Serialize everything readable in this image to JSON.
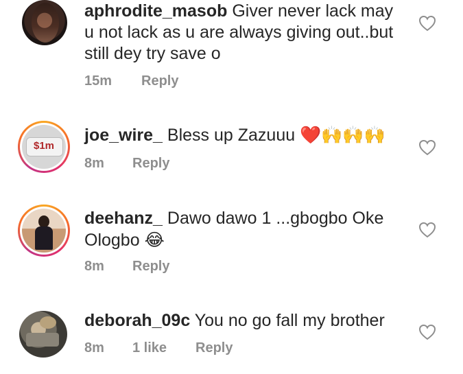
{
  "comments": [
    {
      "username": "aphrodite_masob",
      "text": "Giver never lack may u not lack as u are always giving out..but still dey try save o",
      "time": "15m",
      "likes": "",
      "reply": "Reply",
      "has_story": false
    },
    {
      "username": "joe_wire_",
      "text": "Bless up Zazuuu",
      "emoji": "❤️🙌🙌🙌",
      "time": "8m",
      "likes": "",
      "reply": "Reply",
      "avatar_label": "$1m",
      "has_story": true
    },
    {
      "username": "deehanz_",
      "text": "Dawo dawo 1 ...gbogbo Oke Ologbo",
      "emoji": "😂",
      "time": "8m",
      "likes": "",
      "reply": "Reply",
      "has_story": true
    },
    {
      "username": "deborah_09c",
      "text": "You no go fall my brother",
      "time": "8m",
      "likes": "1 like",
      "reply": "Reply",
      "has_story": false
    }
  ],
  "icons": {
    "like": "heart-outline-icon"
  },
  "colors": {
    "meta_text": "#8e8e8e",
    "story_ring": "#e1306c",
    "heart_stroke": "#8e8e8e"
  }
}
